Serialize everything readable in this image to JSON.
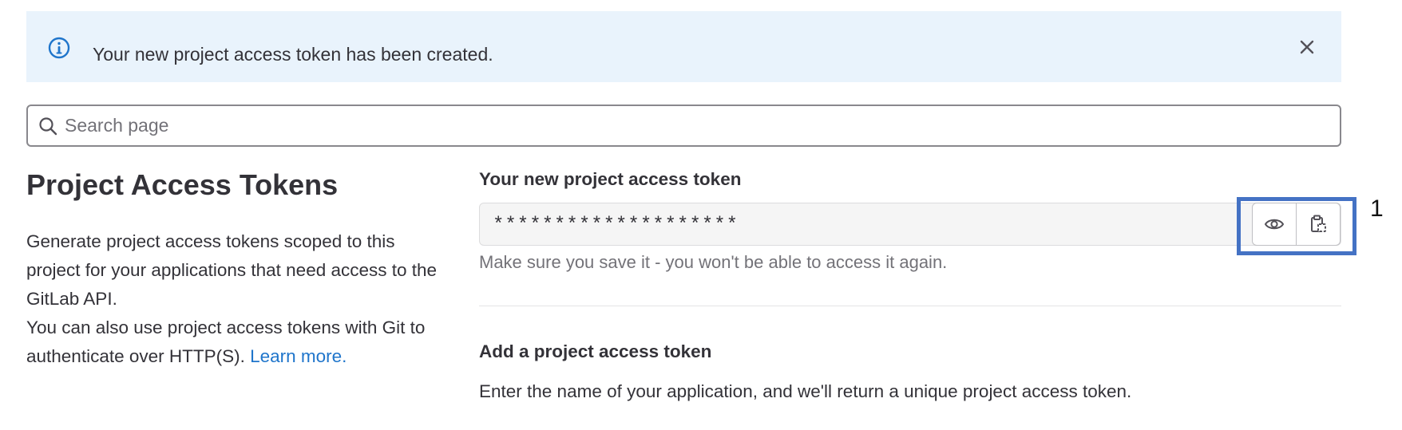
{
  "alert": {
    "message": "Your new project access token has been created.",
    "icons": {
      "info": "info-icon",
      "close": "close-icon"
    },
    "color": "#e9f3fc"
  },
  "search": {
    "placeholder": "Search page",
    "value": "",
    "icon": "search-icon"
  },
  "sidebar": {
    "title": "Project Access Tokens",
    "description_1": "Generate project access tokens scoped to this project for your applications that need access to the GitLab API.",
    "description_2": "You can also use project access tokens with Git to authenticate over HTTP(S).",
    "learn_more": "Learn more."
  },
  "token": {
    "label": "Your new project access token",
    "masked_value": "********************",
    "help_text": "Make sure you save it - you won't be able to access it again.",
    "buttons": {
      "reveal_icon": "eye-icon",
      "copy_icon": "clipboard-icon"
    }
  },
  "add_section": {
    "title": "Add a project access token",
    "description": "Enter the name of your application, and we'll return a unique project access token."
  },
  "annotation": {
    "label": "1",
    "color": "#4472c4"
  },
  "colors": {
    "link": "#1f75cb",
    "text": "#333238",
    "muted": "#737278"
  }
}
